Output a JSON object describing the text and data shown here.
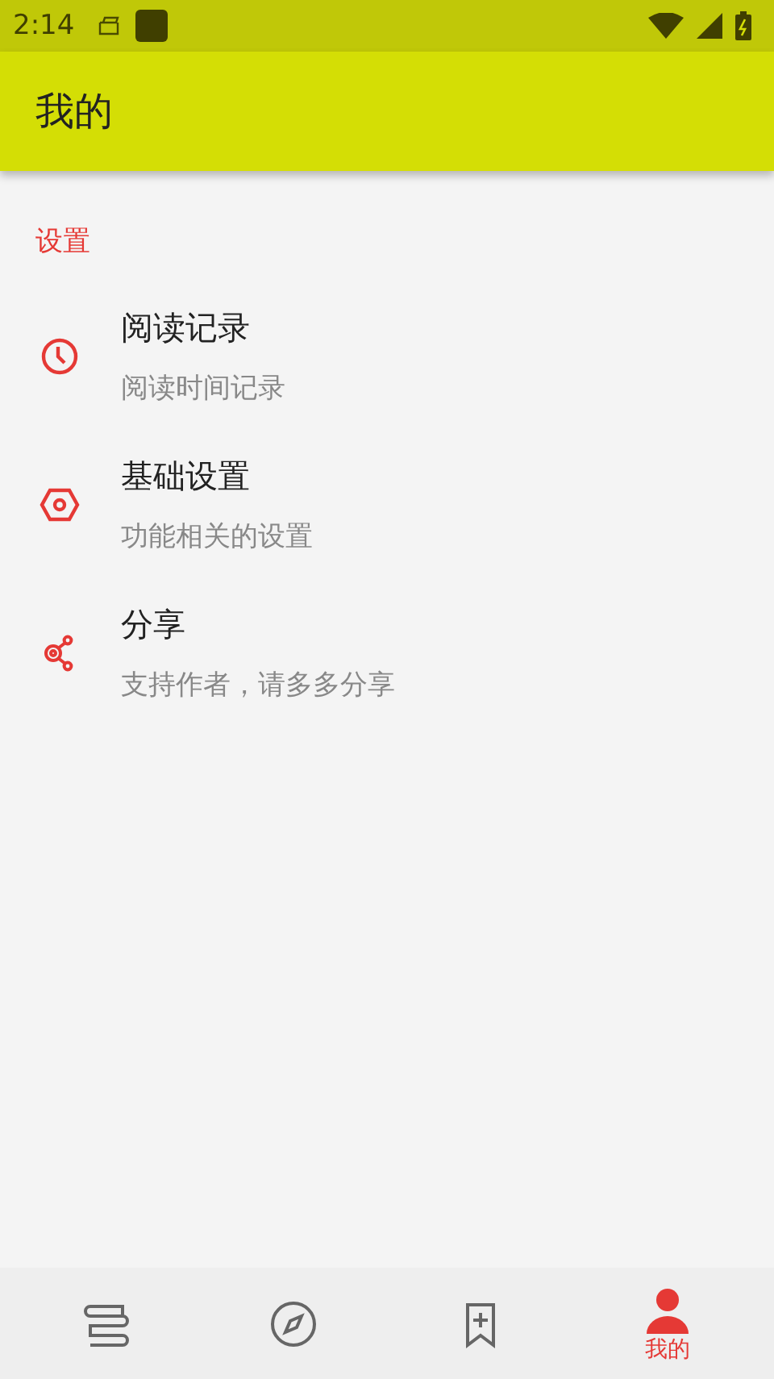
{
  "status_bar": {
    "time": "2:14"
  },
  "app_bar": {
    "title": "我的"
  },
  "section": {
    "title": "设置"
  },
  "items": [
    {
      "kind": "clock",
      "title": "阅读记录",
      "subtitle": "阅读时间记录"
    },
    {
      "kind": "hexagon",
      "title": "基础设置",
      "subtitle": "功能相关的设置"
    },
    {
      "kind": "share",
      "title": "分享",
      "subtitle": "支持作者，请多多分享"
    }
  ],
  "nav": [
    {
      "kind": "books",
      "selected": false
    },
    {
      "kind": "compass",
      "selected": false
    },
    {
      "kind": "bookmark",
      "selected": false
    },
    {
      "kind": "person",
      "label": "我的",
      "selected": true
    }
  ]
}
